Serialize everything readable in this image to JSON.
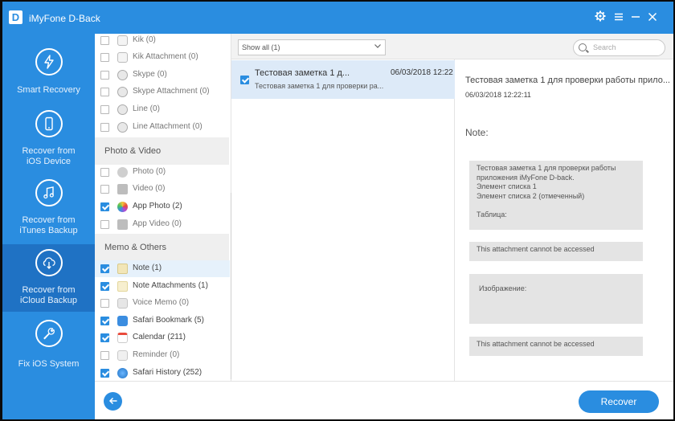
{
  "app": {
    "logo_letter": "D",
    "title": "iMyFone D-Back",
    "accent": "#2a8de0"
  },
  "titlebar": {
    "settings_icon": "gear-icon",
    "menu_icon": "menu-icon",
    "minimize_icon": "minimize-icon",
    "close_icon": "close-icon"
  },
  "sidebar": {
    "items": [
      {
        "label_1": "Smart Recovery",
        "label_2": "",
        "icon": "lightning-icon"
      },
      {
        "label_1": "Recover from",
        "label_2": "iOS Device",
        "icon": "phone-icon"
      },
      {
        "label_1": "Recover from",
        "label_2": "iTunes Backup",
        "icon": "music-icon"
      },
      {
        "label_1": "Recover from",
        "label_2": "iCloud Backup",
        "icon": "cloud-download-icon"
      },
      {
        "label_1": "Fix iOS System",
        "label_2": "",
        "icon": "wrench-icon"
      }
    ],
    "active_index": 3
  },
  "categories": {
    "top_items": [
      {
        "label": "Kik (0)",
        "checked": false
      },
      {
        "label": "Kik Attachment (0)",
        "checked": false
      },
      {
        "label": "Skype (0)",
        "checked": false
      },
      {
        "label": "Skype Attachment (0)",
        "checked": false
      },
      {
        "label": "Line (0)",
        "checked": false
      },
      {
        "label": "Line Attachment (0)",
        "checked": false
      }
    ],
    "photo_video_header": "Photo & Video",
    "photo_video_items": [
      {
        "label": "Photo (0)",
        "checked": false
      },
      {
        "label": "Video (0)",
        "checked": false
      },
      {
        "label": "App Photo (2)",
        "checked": true
      },
      {
        "label": "App Video (0)",
        "checked": false
      }
    ],
    "memo_header": "Memo & Others",
    "memo_items": [
      {
        "label": "Note (1)",
        "checked": true
      },
      {
        "label": "Note Attachments (1)",
        "checked": true
      },
      {
        "label": "Voice Memo (0)",
        "checked": false
      },
      {
        "label": "Safari Bookmark (5)",
        "checked": true
      },
      {
        "label": "Calendar (211)",
        "checked": true
      },
      {
        "label": "Reminder (0)",
        "checked": false
      },
      {
        "label": "Safari History (252)",
        "checked": true
      }
    ]
  },
  "list": {
    "filter_value": "Show all (1)",
    "items": [
      {
        "title": "Тестовая заметка 1 д...",
        "date": "06/03/2018 12:22",
        "subtitle": "Тестовая заметка 1 для проверки ра...",
        "checked": true
      }
    ]
  },
  "search": {
    "placeholder": "Search"
  },
  "detail": {
    "title": "Тестовая заметка 1 для проверки работы прило...",
    "date": "06/03/2018 12:22:11",
    "note_label": "Note:",
    "body_lines": [
      "Тестовая заметка 1 для проверки работы",
      "приложения iMyFone D-back.",
      "Элемент списка 1",
      "Элемент списка 2 (отмеченный)",
      "",
      "Таблица:"
    ],
    "attachment_msg_1": "This attachment cannot be accessed",
    "image_label": "Изображение:",
    "attachment_msg_2": "This attachment cannot be accessed"
  },
  "bottom": {
    "back_icon": "arrow-left-icon",
    "recover_label": "Recover"
  }
}
